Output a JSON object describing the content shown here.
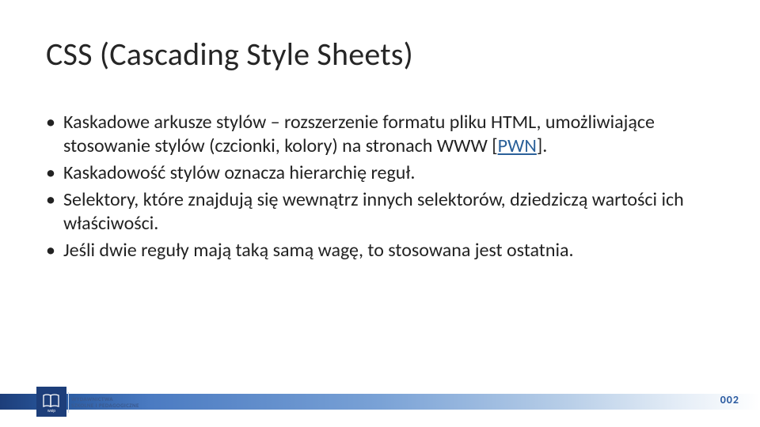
{
  "title": "CSS (Cascading Style Sheets)",
  "bullets": [
    {
      "pre": "Kaskadowe arkusze stylów – rozszerzenie formatu pliku HTML, umożliwiające stosowanie stylów (czcionki, kolory) na stronach WWW ",
      "linkOpen": "[",
      "linkText": "PWN",
      "linkClose": "]",
      "post": "."
    },
    {
      "text": "Kaskadowość stylów oznacza hierarchię reguł."
    },
    {
      "text": "Selektory, które znajdują się wewnątrz innych selektorów, dziedziczą wartości ich właściwości."
    },
    {
      "text": "Jeśli dwie reguły mają taką samą wagę, to stosowana jest ostatnia."
    }
  ],
  "footer": {
    "logoLabel": "wsip",
    "captionLine1": "WYDAWNICTWA",
    "captionLine2": "SZKOLNE I PEDAGOGICZNE",
    "pageNumber": "002"
  },
  "colors": {
    "brand": "#1d3e7a",
    "link": "#2a6099"
  }
}
